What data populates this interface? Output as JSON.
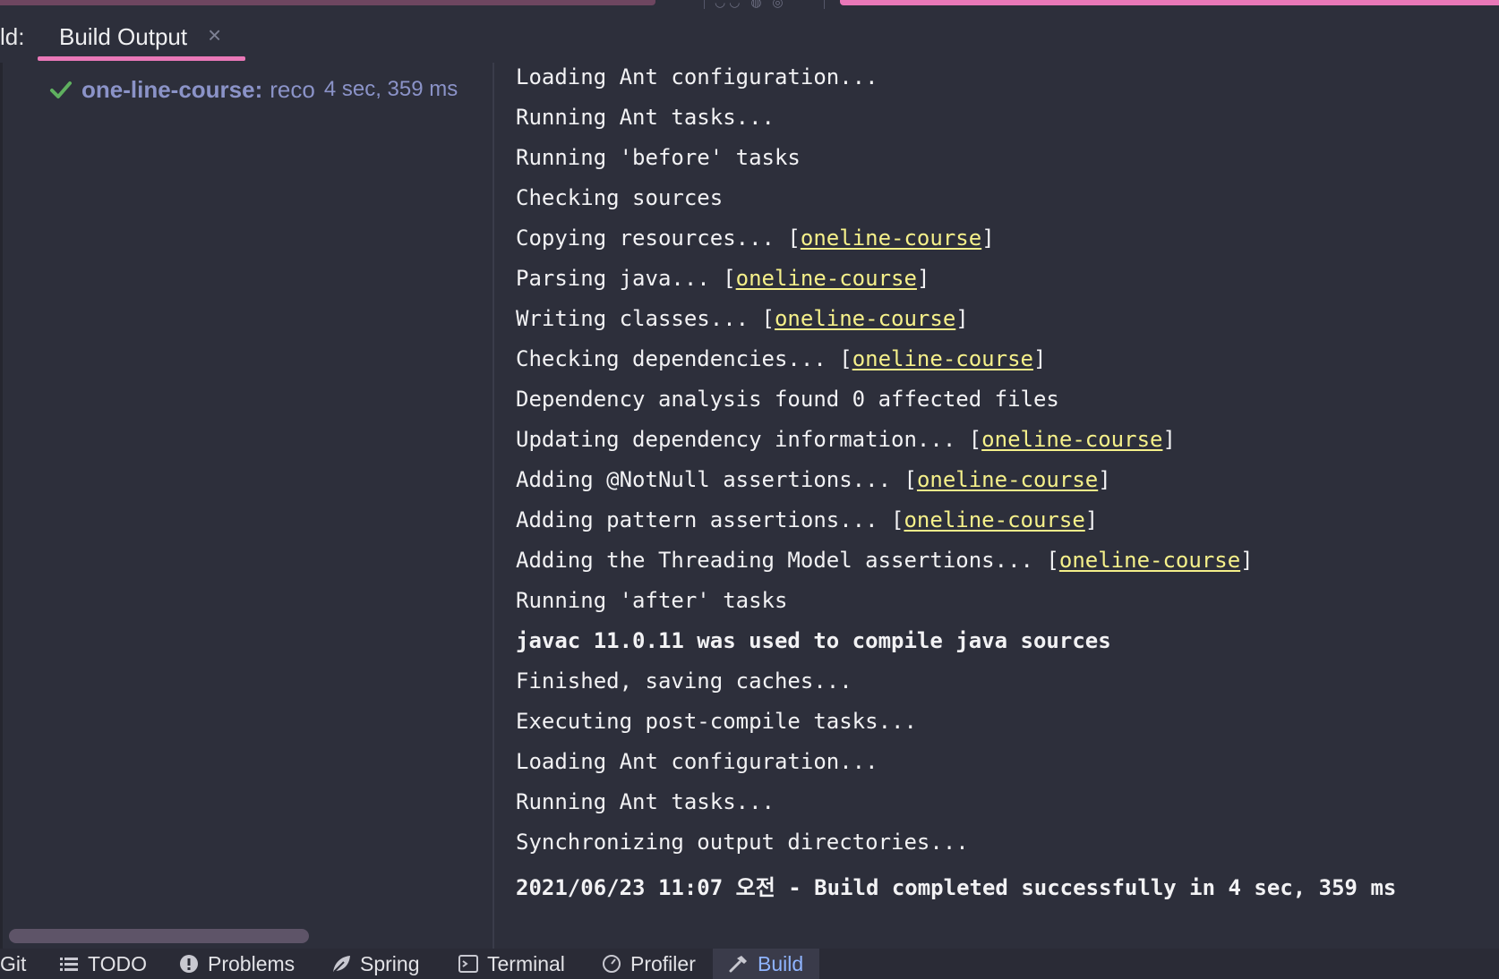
{
  "colors": {
    "background": "#2d2f3b",
    "accent": "#e978b8",
    "success": "#5fb05f",
    "link": "#f5f08a",
    "tree_text": "#8b93c8",
    "active_tool": "#8fb4ff"
  },
  "tab_header": {
    "prefix": "ld:",
    "tab_label": "Build Output",
    "close_icon": "close-icon"
  },
  "tree": {
    "status_icon": "check-icon",
    "name": "one-line-course:",
    "status": "reco",
    "time": "4 sec, 359 ms"
  },
  "console": {
    "lines": [
      {
        "text": "Loading Ant configuration...",
        "link": "",
        "suffix": "",
        "bold": false
      },
      {
        "text": "Running Ant tasks...",
        "link": "",
        "suffix": "",
        "bold": false
      },
      {
        "text": "Running 'before' tasks",
        "link": "",
        "suffix": "",
        "bold": false
      },
      {
        "text": "Checking sources",
        "link": "",
        "suffix": "",
        "bold": false
      },
      {
        "text": "Copying resources... [",
        "link": "oneline-course",
        "suffix": "]",
        "bold": false
      },
      {
        "text": "Parsing java... [",
        "link": "oneline-course",
        "suffix": "]",
        "bold": false
      },
      {
        "text": "Writing classes... [",
        "link": "oneline-course",
        "suffix": "]",
        "bold": false
      },
      {
        "text": "Checking dependencies... [",
        "link": "oneline-course",
        "suffix": "]",
        "bold": false
      },
      {
        "text": "Dependency analysis found 0 affected files",
        "link": "",
        "suffix": "",
        "bold": false
      },
      {
        "text": "Updating dependency information... [",
        "link": "oneline-course",
        "suffix": "]",
        "bold": false
      },
      {
        "text": "Adding @NotNull assertions... [",
        "link": "oneline-course",
        "suffix": "]",
        "bold": false
      },
      {
        "text": "Adding pattern assertions... [",
        "link": "oneline-course",
        "suffix": "]",
        "bold": false
      },
      {
        "text": "Adding the Threading Model assertions... [",
        "link": "oneline-course",
        "suffix": "]",
        "bold": false
      },
      {
        "text": "Running 'after' tasks",
        "link": "",
        "suffix": "",
        "bold": false
      },
      {
        "text": "javac 11.0.11 was used to compile java sources",
        "link": "",
        "suffix": "",
        "bold": true
      },
      {
        "text": "Finished, saving caches...",
        "link": "",
        "suffix": "",
        "bold": false
      },
      {
        "text": "Executing post-compile tasks...",
        "link": "",
        "suffix": "",
        "bold": false
      },
      {
        "text": "Loading Ant configuration...",
        "link": "",
        "suffix": "",
        "bold": false
      },
      {
        "text": "Running Ant tasks...",
        "link": "",
        "suffix": "",
        "bold": false
      },
      {
        "text": "Synchronizing output directories...",
        "link": "",
        "suffix": "",
        "bold": false
      },
      {
        "text": "2021/06/23 11:07 오전 - Build completed successfully in 4 sec, 359 ms",
        "link": "",
        "suffix": "",
        "bold": true
      }
    ]
  },
  "bottom_bar": {
    "tools": [
      {
        "name": "tool-git",
        "icon": "git-icon",
        "label": "Git",
        "active": false
      },
      {
        "name": "tool-todo",
        "icon": "list-icon",
        "label": "TODO",
        "active": false
      },
      {
        "name": "tool-problems",
        "icon": "warning-icon",
        "label": "Problems",
        "active": false
      },
      {
        "name": "tool-spring",
        "icon": "leaf-icon",
        "label": "Spring",
        "active": false
      },
      {
        "name": "tool-terminal",
        "icon": "terminal-icon",
        "label": "Terminal",
        "active": false
      },
      {
        "name": "tool-profiler",
        "icon": "gauge-icon",
        "label": "Profiler",
        "active": false
      },
      {
        "name": "tool-build",
        "icon": "hammer-icon",
        "label": "Build",
        "active": true
      }
    ]
  }
}
